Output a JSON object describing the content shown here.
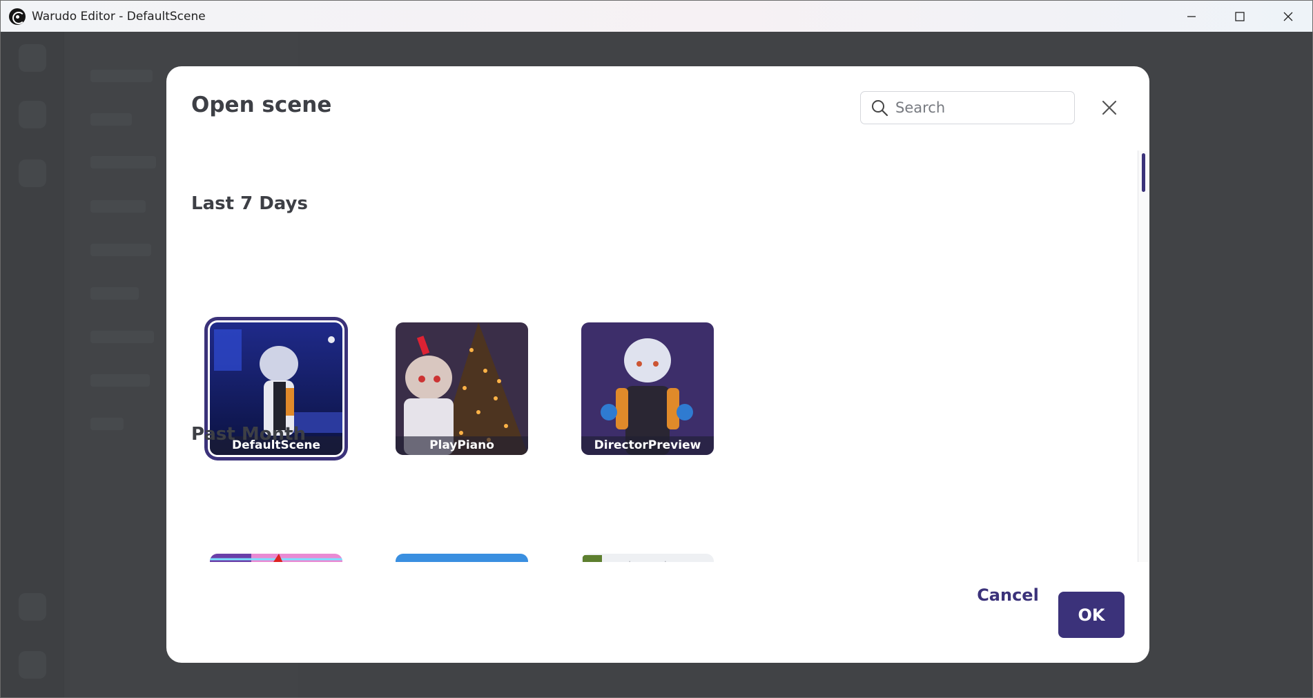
{
  "window": {
    "title": "Warudo Editor - DefaultScene"
  },
  "dialog": {
    "title": "Open scene",
    "search": {
      "placeholder": "Search",
      "value": ""
    },
    "sections": [
      {
        "title": "Last 7 Days",
        "scenes": [
          "DefaultScene",
          "PlayPiano",
          "DirectorPreview"
        ]
      },
      {
        "title": "Past Month",
        "scenes": [
          "",
          "",
          ""
        ]
      }
    ],
    "cancel_label": "Cancel",
    "ok_label": "OK"
  },
  "colors": {
    "accent": "#3b327a",
    "backdrop": "#4a4c4f"
  },
  "icons": [
    "app-logo-icon",
    "minimize-icon",
    "maximize-icon",
    "window-close-icon",
    "search-icon",
    "dialog-close-icon"
  ]
}
